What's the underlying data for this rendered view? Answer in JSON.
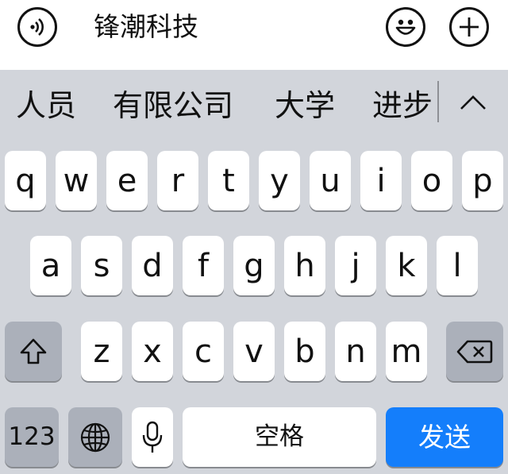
{
  "input": {
    "text": "锋潮科技"
  },
  "candidates": [
    "人员",
    "有限公司",
    "大学",
    "进步"
  ],
  "keyboard": {
    "row1": [
      "q",
      "w",
      "e",
      "r",
      "t",
      "y",
      "u",
      "i",
      "o",
      "p"
    ],
    "row2": [
      "a",
      "s",
      "d",
      "f",
      "g",
      "h",
      "j",
      "k",
      "l"
    ],
    "row3": [
      "z",
      "x",
      "c",
      "v",
      "b",
      "n",
      "m"
    ],
    "numbers_label": "123",
    "space_label": "空格",
    "send_label": "发送"
  },
  "icons": {
    "voice": "voice-wave-icon",
    "emoji": "smiley-icon",
    "add": "plus-icon",
    "collapse": "chevron-up-icon",
    "shift": "shift-arrow-icon",
    "delete": "backspace-icon",
    "globe": "globe-icon",
    "mic": "microphone-icon"
  },
  "colors": {
    "send": "#147efb",
    "keyboard_bg": "#d2d5db",
    "key": "#ffffff",
    "func_key": "#abb0ba"
  }
}
